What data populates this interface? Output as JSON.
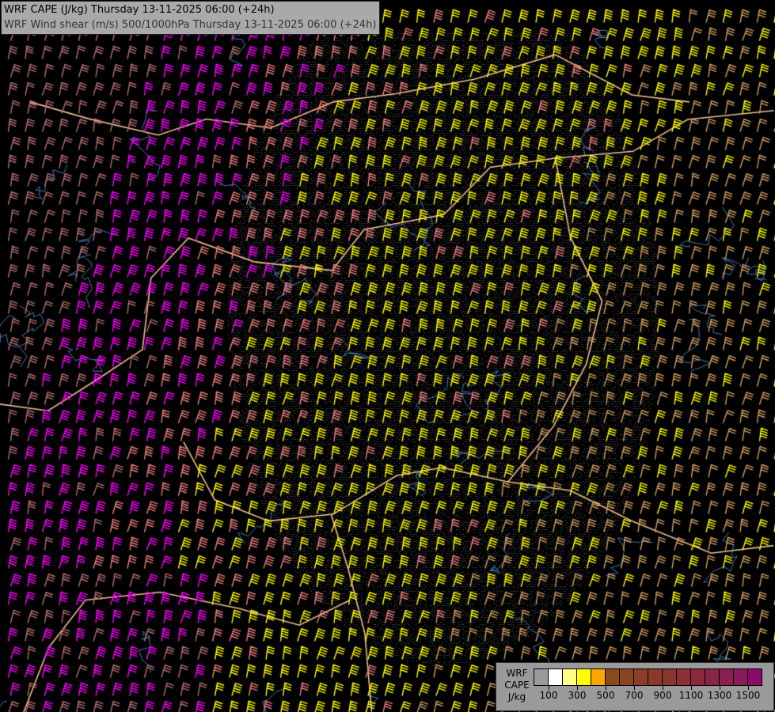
{
  "title": {
    "line1": "WRF CAPE (J/kg) Thursday 13-11-2025 06:00 (+24h)",
    "line2": "WRF Wind shear (m/s) 500/1000hPa Thursday 13-11-2025 06:00 (+24h)"
  },
  "legend": {
    "label_lines": [
      "WRF",
      "CAPE",
      "J/kg"
    ],
    "colors": [
      "#9a9a9a",
      "#ffffff",
      "#ffff88",
      "#ffff00",
      "#ffa500",
      "#8b4a1a",
      "#8b4520",
      "#8b3f25",
      "#8b3a2a",
      "#8b3530",
      "#8b3036",
      "#8b2a3c",
      "#8b2545",
      "#8b1f50",
      "#8b1a5c",
      "#8b0a6a"
    ],
    "ticks": [
      "100",
      "300",
      "500",
      "700",
      "900",
      "1100",
      "1300",
      "1500"
    ]
  },
  "map": {
    "barb_colors": {
      "strong": "#ff00ff",
      "moderate_high": "#f08080",
      "moderate": "#ffff00",
      "low": "#d2a060",
      "weak": "#b87070"
    },
    "border_color": "#f0c090",
    "river_color": "#4a78b0"
  }
}
